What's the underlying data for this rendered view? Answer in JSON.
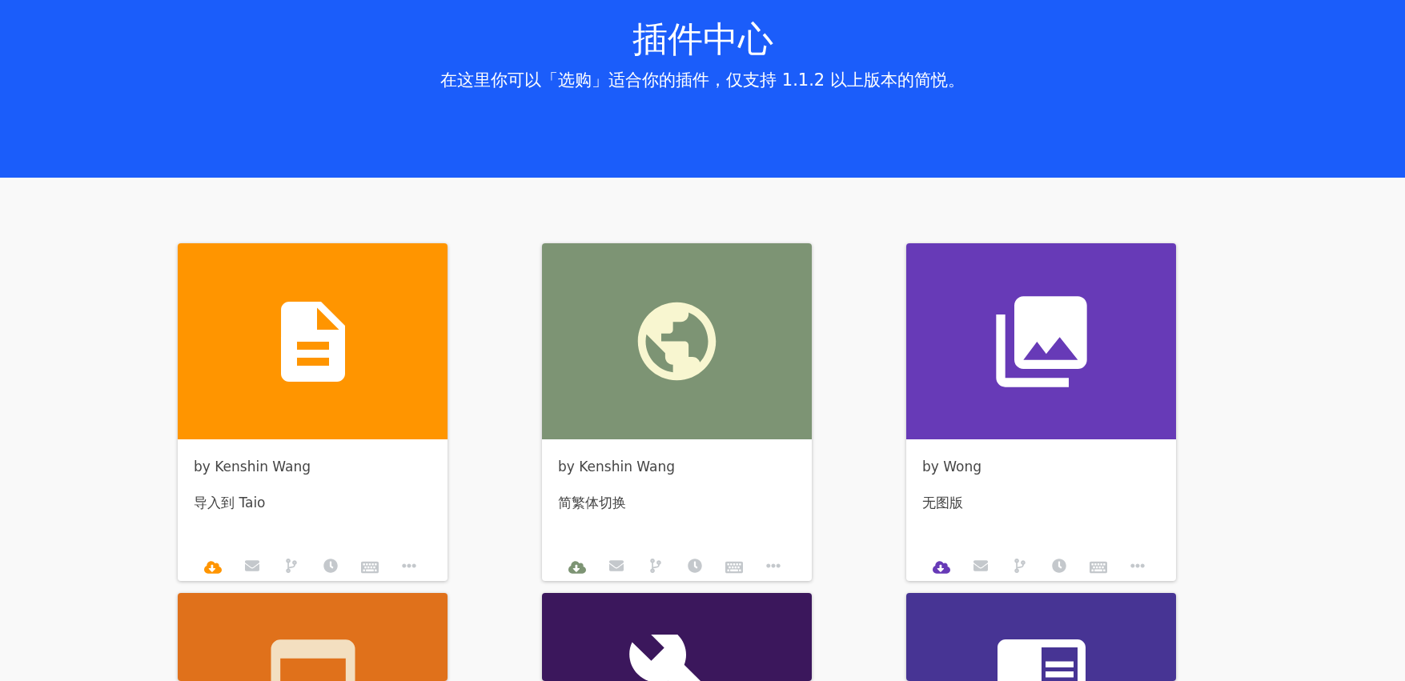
{
  "header": {
    "title": "插件中心",
    "subtitle": "在这里你可以「选购」适合你的插件，仅支持 1.1.2 以上版本的简悦。"
  },
  "plugins": [
    {
      "kind": "document",
      "color": "#ff9500",
      "author": "by Kenshin Wang",
      "name": "导入到 Taio"
    },
    {
      "kind": "globe",
      "color": "#7d9474",
      "author": "by Kenshin Wang",
      "name": "简繁体切换"
    },
    {
      "kind": "images",
      "color": "#673ab7",
      "author": "by Wong",
      "name": "无图版"
    },
    {
      "kind": "browser",
      "color": "#e0711b"
    },
    {
      "kind": "tool",
      "color": "#3b175c"
    },
    {
      "kind": "card",
      "color": "#473494"
    }
  ]
}
